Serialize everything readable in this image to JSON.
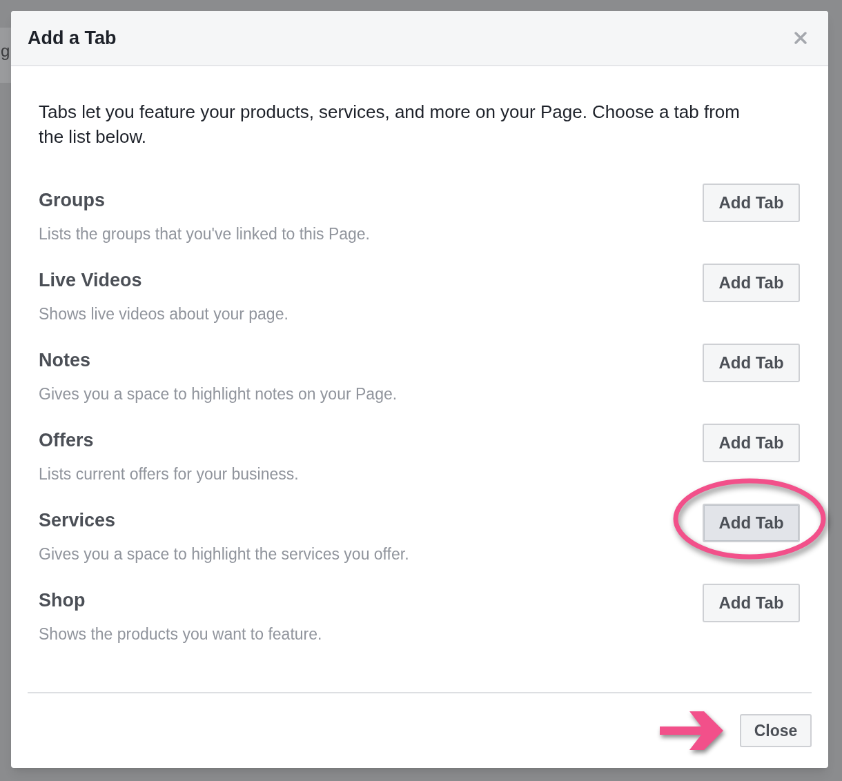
{
  "background": {
    "text_fragment": "g"
  },
  "dialog": {
    "title": "Add a Tab",
    "intro": "Tabs let you feature your products, services, and more on your Page. Choose a tab from the list below.",
    "tabs": [
      {
        "name": "Groups",
        "description": "Lists the groups that you've linked to this Page.",
        "button": "Add Tab",
        "highlighted": false
      },
      {
        "name": "Live Videos",
        "description": "Shows live videos about your page.",
        "button": "Add Tab",
        "highlighted": false
      },
      {
        "name": "Notes",
        "description": "Gives you a space to highlight notes on your Page.",
        "button": "Add Tab",
        "highlighted": false
      },
      {
        "name": "Offers",
        "description": "Lists current offers for your business.",
        "button": "Add Tab",
        "highlighted": false
      },
      {
        "name": "Services",
        "description": "Gives you a space to highlight the services you offer.",
        "button": "Add Tab",
        "highlighted": true
      },
      {
        "name": "Shop",
        "description": "Shows the products you want to feature.",
        "button": "Add Tab",
        "highlighted": false
      }
    ],
    "footer": {
      "close_button": "Close"
    }
  }
}
